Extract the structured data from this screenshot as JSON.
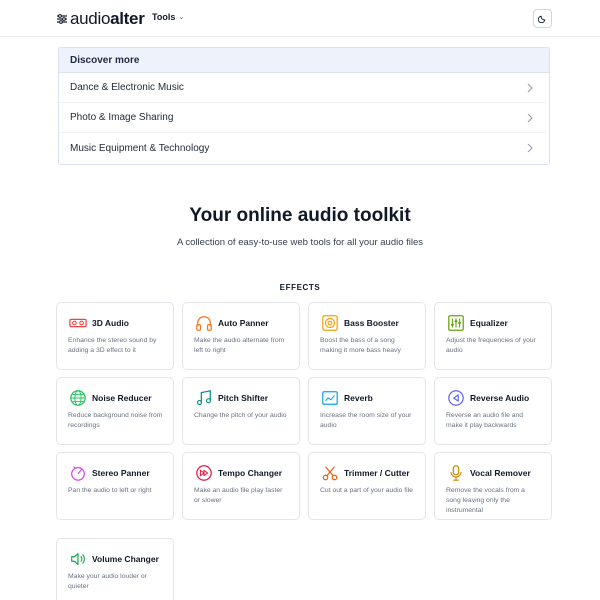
{
  "header": {
    "logo_light": "audio",
    "logo_bold": "alter",
    "nav_tools_label": "Tools"
  },
  "discover": {
    "heading": "Discover more",
    "items": [
      {
        "label": "Dance & Electronic Music"
      },
      {
        "label": "Photo & Image Sharing"
      },
      {
        "label": "Music Equipment & Technology"
      }
    ]
  },
  "hero": {
    "title": "Your online audio toolkit",
    "subtitle": "A collection of easy-to-use web tools for all your audio files"
  },
  "effects": {
    "section_title": "EFFECTS",
    "cards": [
      {
        "title": "3D Audio",
        "desc": "Enhance the stereo sound by adding a 3D effect to it",
        "icon": "3d-glasses-icon",
        "color": "#ef4444"
      },
      {
        "title": "Auto Panner",
        "desc": "Make the audio alternate from left to right",
        "icon": "headphones-icon",
        "color": "#f97316"
      },
      {
        "title": "Bass Booster",
        "desc": "Boost the bass of a song making it more bass heavy",
        "icon": "speaker-icon",
        "color": "#f59e0b"
      },
      {
        "title": "Equalizer",
        "desc": "Adjust the frequencies of your audio",
        "icon": "equalizer-icon",
        "color": "#65a30d"
      },
      {
        "title": "Noise Reducer",
        "desc": "Reduce background noise from recordings",
        "icon": "globe-icon",
        "color": "#22c55e"
      },
      {
        "title": "Pitch Shifter",
        "desc": "Change the pitch of your audio",
        "icon": "music-notes-icon",
        "color": "#0d9488"
      },
      {
        "title": "Reverb",
        "desc": "Increase the room size of your audio",
        "icon": "reverb-icon",
        "color": "#0ea5e9"
      },
      {
        "title": "Reverse Audio",
        "desc": "Reverse an audio file and make it play backwards",
        "icon": "reverse-icon",
        "color": "#6366f1"
      },
      {
        "title": "Stereo Panner",
        "desc": "Pan the audio to left or right",
        "icon": "pan-dial-icon",
        "color": "#d946ef"
      },
      {
        "title": "Tempo Changer",
        "desc": "Make an audio file play faster or slower",
        "icon": "fast-forward-icon",
        "color": "#e11d48"
      },
      {
        "title": "Trimmer / Cutter",
        "desc": "Cut out a part of your audio file",
        "icon": "scissors-icon",
        "color": "#ea580c"
      },
      {
        "title": "Vocal Remover",
        "desc": "Remove the vocals from a song leaving only the instrumental",
        "icon": "microphone-icon",
        "color": "#ca8a04"
      },
      {
        "title": "Volume Changer",
        "desc": "Make your audio louder or quieter",
        "icon": "volume-icon",
        "color": "#16a34a"
      }
    ]
  }
}
